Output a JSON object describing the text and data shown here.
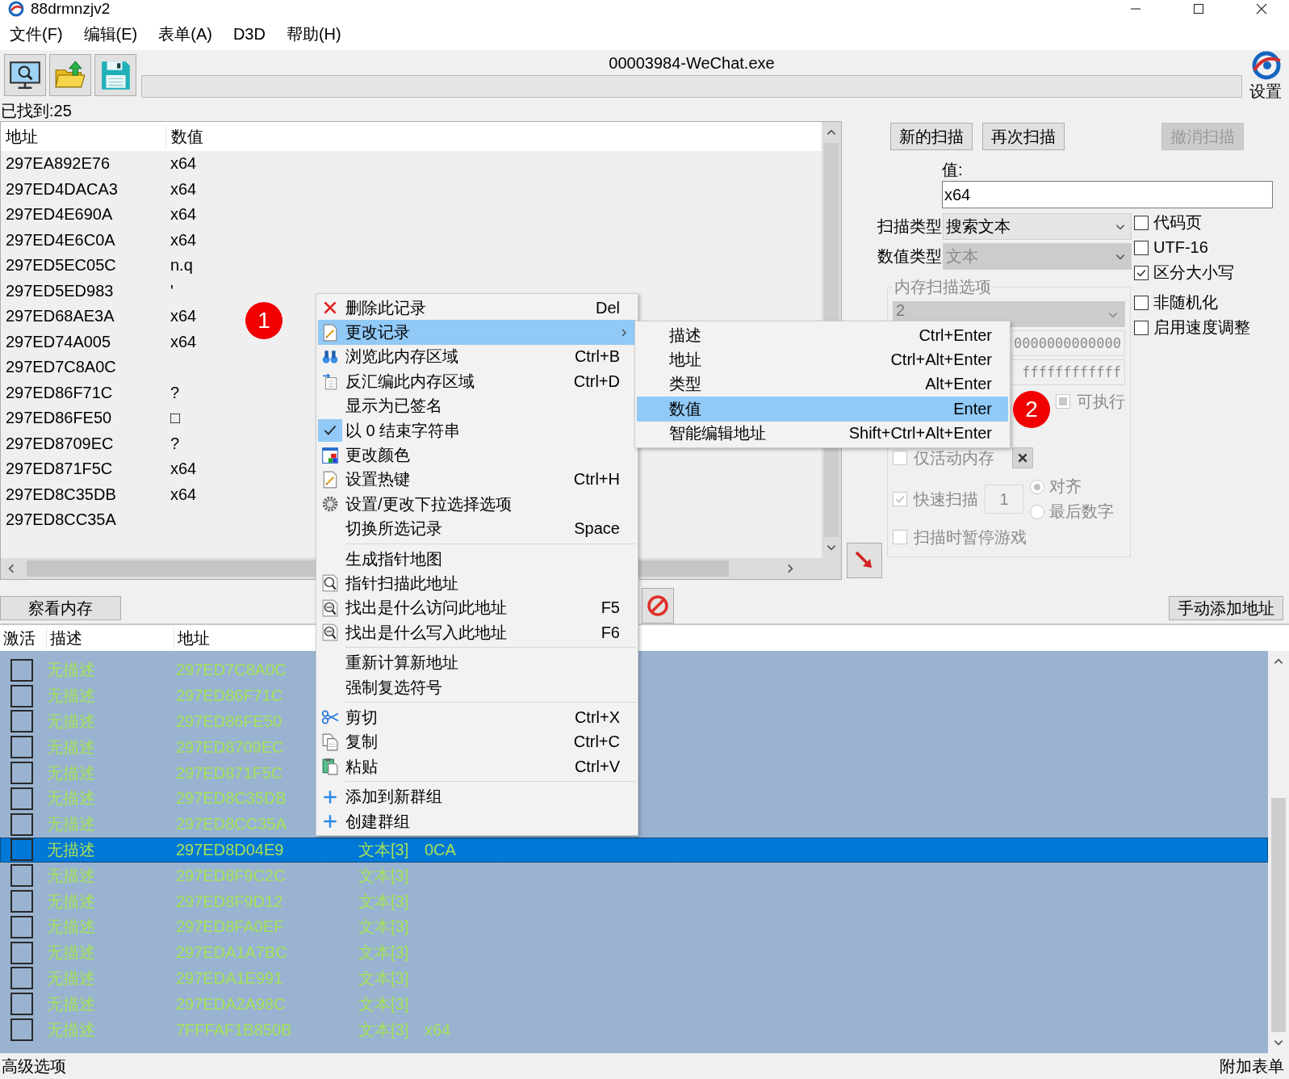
{
  "window": {
    "title": "88drmnzjv2"
  },
  "menu_bar": [
    "文件(F)",
    "编辑(E)",
    "表单(A)",
    "D3D",
    "帮助(H)"
  ],
  "toolbar": {
    "process": "00003984-WeChat.exe",
    "settings_label": "设置"
  },
  "found_count": "已找到:25",
  "found_list": {
    "columns": [
      "地址",
      "数值"
    ],
    "rows": [
      {
        "address": "297EA892E76",
        "value": "x64"
      },
      {
        "address": "297ED4DACA3",
        "value": "x64"
      },
      {
        "address": "297ED4E690A",
        "value": "x64"
      },
      {
        "address": "297ED4E6C0A",
        "value": "x64"
      },
      {
        "address": "297ED5EC05C",
        "value": "n.q"
      },
      {
        "address": "297ED5ED983",
        "value": "'"
      },
      {
        "address": "297ED68AE3A",
        "value": "x64"
      },
      {
        "address": "297ED74A005",
        "value": "x64"
      },
      {
        "address": "297ED7C8A0C"
      },
      {
        "address": "297ED86F71C",
        "value": "?"
      },
      {
        "address": "297ED86FE50",
        "value": "□"
      },
      {
        "address": "297ED8709EC",
        "value": "?"
      },
      {
        "address": "297ED871F5C",
        "value": "x64"
      },
      {
        "address": "297ED8C35DB",
        "value": "x64"
      },
      {
        "address": "297ED8CC35A"
      }
    ]
  },
  "scan": {
    "buttons": [
      {
        "label": "新的扫描",
        "disabled": false
      },
      {
        "label": "再次扫描",
        "disabled": false
      },
      {
        "label": "撤消扫描",
        "disabled": true
      }
    ],
    "value_label": "值:",
    "value": "x64",
    "selects": [
      {
        "label": "扫描类型",
        "value": "搜索文本",
        "disabled": false
      },
      {
        "label": "数值类型",
        "value": "文本",
        "disabled": true
      }
    ],
    "options": [
      {
        "label": "代码页",
        "checked": false
      },
      {
        "label": "UTF-16",
        "checked": false
      },
      {
        "label": "区分大小写",
        "checked": true
      },
      {
        "label": "非随机化",
        "checked": false
      },
      {
        "label": "启用速度调整",
        "checked": false
      }
    ],
    "memory": {
      "title": "内存扫描选项",
      "region": "2",
      "start": "0000000000000",
      "stop": "ffffffffffff",
      "executable": {
        "label": "可执行",
        "indeterminate": true
      },
      "active_only": {
        "label": "仅活动内存",
        "checked": false
      },
      "fast_scan": {
        "label": "快速扫描",
        "checked": true,
        "value": "1"
      },
      "alignment": [
        {
          "label": "对齐",
          "selected": true
        },
        {
          "label": "最后数字",
          "selected": false
        }
      ],
      "pause": {
        "label": "扫描时暂停游戏",
        "checked": false
      }
    }
  },
  "actions": {
    "view_memory": "察看内存",
    "add_address": "手动添加地址"
  },
  "address_list": {
    "columns": [
      "激活",
      "描述",
      "地址"
    ],
    "rows": [
      {
        "active": false,
        "description": "无描述",
        "address": "297ED7C8A0C",
        "selected": true,
        "focused": false
      },
      {
        "active": false,
        "description": "无描述",
        "address": "297ED86F71C",
        "selected": true,
        "focused": false
      },
      {
        "active": false,
        "description": "无描述",
        "address": "297ED86FE50",
        "selected": true,
        "focused": false
      },
      {
        "active": false,
        "description": "无描述",
        "address": "297ED8709EC",
        "selected": true,
        "focused": false
      },
      {
        "active": false,
        "description": "无描述",
        "address": "297ED871F5C",
        "selected": true,
        "focused": false
      },
      {
        "active": false,
        "description": "无描述",
        "address": "297ED8C35DB",
        "selected": true,
        "focused": false
      },
      {
        "active": false,
        "description": "无描述",
        "address": "297ED8CC35A",
        "selected": true,
        "focused": false
      },
      {
        "active": false,
        "description": "无描述",
        "address": "297ED8D04E9",
        "type": "文本[3]",
        "value": "0CA",
        "selected": true,
        "focused": true
      },
      {
        "active": false,
        "description": "无描述",
        "address": "297ED8F9C2C",
        "type": "文本[3]",
        "selected": true,
        "focused": false
      },
      {
        "active": false,
        "description": "无描述",
        "address": "297ED8F9D12",
        "type": "文本[3]",
        "selected": true,
        "focused": false
      },
      {
        "active": false,
        "description": "无描述",
        "address": "297ED8FA0EF",
        "type": "文本[3]",
        "selected": true,
        "focused": false
      },
      {
        "active": false,
        "description": "无描述",
        "address": "297EDA1A7BC",
        "type": "文本[3]",
        "selected": true,
        "focused": false
      },
      {
        "active": false,
        "description": "无描述",
        "address": "297EDA1E991",
        "type": "文本[3]",
        "selected": true,
        "focused": false
      },
      {
        "active": false,
        "description": "无描述",
        "address": "297EDA2A98C",
        "type": "文本[3]",
        "selected": true,
        "focused": false
      },
      {
        "active": false,
        "description": "无描述",
        "address": "7FFFAF1B850B",
        "type": "文本[3]",
        "value": "x64",
        "selected": true,
        "focused": false
      }
    ]
  },
  "context_menu": {
    "sections": [
      [
        {
          "label": "删除此记录",
          "shortcut": "Del",
          "selected": false,
          "checked": false
        },
        {
          "label": "更改记录",
          "submenu": true,
          "selected": true,
          "checked": false
        },
        {
          "label": "浏览此内存区域",
          "shortcut": "Ctrl+B",
          "selected": false,
          "checked": false
        },
        {
          "label": "反汇编此内存区域",
          "shortcut": "Ctrl+D",
          "selected": false,
          "checked": false
        },
        {
          "label": "显示为已签名",
          "selected": false,
          "checked": false
        },
        {
          "label": "以 0 结束字符串",
          "selected": false,
          "checked": true
        },
        {
          "label": "更改颜色",
          "selected": false,
          "checked": false
        },
        {
          "label": "设置热键",
          "shortcut": "Ctrl+H",
          "selected": false,
          "checked": false
        },
        {
          "label": "设置/更改下拉选择选项",
          "selected": false,
          "checked": false
        },
        {
          "label": "切换所选记录",
          "shortcut": "Space",
          "selected": false,
          "checked": false
        }
      ],
      [
        {
          "label": "生成指针地图",
          "selected": false,
          "checked": false
        },
        {
          "label": "指针扫描此地址",
          "selected": false,
          "checked": false
        },
        {
          "label": "找出是什么访问此地址",
          "shortcut": "F5",
          "selected": false,
          "checked": false
        },
        {
          "label": "找出是什么写入此地址",
          "shortcut": "F6",
          "selected": false,
          "checked": false
        }
      ],
      [
        {
          "label": "重新计算新地址",
          "selected": false,
          "checked": false
        },
        {
          "label": "强制复选符号",
          "selected": false,
          "checked": false
        }
      ],
      [
        {
          "label": "剪切",
          "shortcut": "Ctrl+X",
          "selected": false,
          "checked": false
        },
        {
          "label": "复制",
          "shortcut": "Ctrl+C",
          "selected": false,
          "checked": false
        },
        {
          "label": "粘贴",
          "shortcut": "Ctrl+V",
          "selected": false,
          "checked": false
        }
      ],
      [
        {
          "label": "添加到新群组",
          "selected": false,
          "checked": false
        },
        {
          "label": "创建群组",
          "selected": false,
          "checked": false
        }
      ]
    ]
  },
  "submenu": {
    "items": [
      {
        "label": "描述",
        "shortcut": "Ctrl+Enter",
        "selected": false
      },
      {
        "label": "地址",
        "shortcut": "Ctrl+Alt+Enter",
        "selected": false
      },
      {
        "label": "类型",
        "shortcut": "Alt+Enter",
        "selected": false
      },
      {
        "label": "数值",
        "shortcut": "Enter",
        "selected": true
      },
      {
        "label": "智能编辑地址",
        "shortcut": "Shift+Ctrl+Alt+Enter",
        "selected": false
      }
    ]
  },
  "annotations": [
    "1",
    "2"
  ],
  "status_bar": {
    "left": "高级选项",
    "right": "附加表单"
  }
}
